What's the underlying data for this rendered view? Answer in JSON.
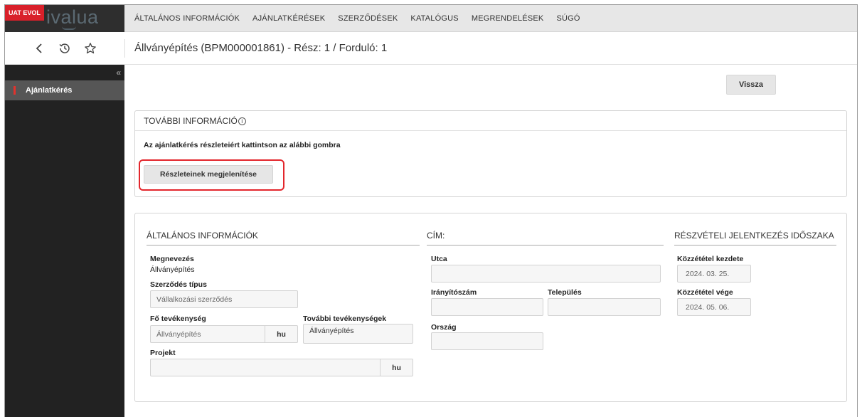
{
  "header": {
    "env_badge": "UAT EVOL",
    "logo": "ivalua",
    "nav": [
      "ÁLTALÁNOS INFORMÁCIÓK",
      "AJÁNLATKÉRÉSEK",
      "SZERZŐDÉSEK",
      "KATALÓGUS",
      "MEGRENDELÉSEK",
      "SÚGÓ"
    ]
  },
  "titlebar": {
    "title": "Állványépítés (BPM000001861) - Rész: 1 / Forduló: 1",
    "icons": [
      "back-chevron-icon",
      "history-icon",
      "star-icon"
    ]
  },
  "sidebar": {
    "collapse_glyph": "«",
    "items": [
      {
        "label": "Ajánlatkérés",
        "active": true
      }
    ]
  },
  "actions": {
    "back_label": "Vissza"
  },
  "more_info": {
    "title": "TOVÁBBI INFORMÁCIÓ",
    "text": "Az ajánlatkérés részleteiért kattintson az alábbi gombra",
    "button_label": "Részleteinek megjelenítése"
  },
  "general": {
    "title": "ÁLTALÁNOS INFORMÁCIÓK",
    "name_label": "Megnevezés",
    "name_value": "Állványépítés",
    "contract_type_label": "Szerződés típus",
    "contract_type_value": "Vállalkozási szerződés",
    "main_activity_label": "Fő tevékenység",
    "main_activity_value": "Állványépítés",
    "main_activity_lang": "hu",
    "other_activities_label": "További tevékenységek",
    "other_activities_value": "Állványépítés",
    "project_label": "Projekt",
    "project_value": "",
    "project_lang": "hu"
  },
  "address": {
    "title": "CÍM:",
    "street_label": "Utca",
    "street_value": "",
    "zip_label": "Irányítószám",
    "zip_value": "",
    "city_label": "Település",
    "city_value": "",
    "country_label": "Ország",
    "country_value": ""
  },
  "registration": {
    "title": "RÉSZVÉTELI JELENTKEZÉS IDŐSZAKA",
    "start_label": "Közzététel kezdete",
    "start_value": "2024. 03. 25.",
    "end_label": "Közzététel vége",
    "end_value": "2024. 05. 06."
  },
  "colors": {
    "accent_red": "#e3262c",
    "sidebar_bg": "#222222",
    "topbar_bg": "#e7e7e7"
  }
}
